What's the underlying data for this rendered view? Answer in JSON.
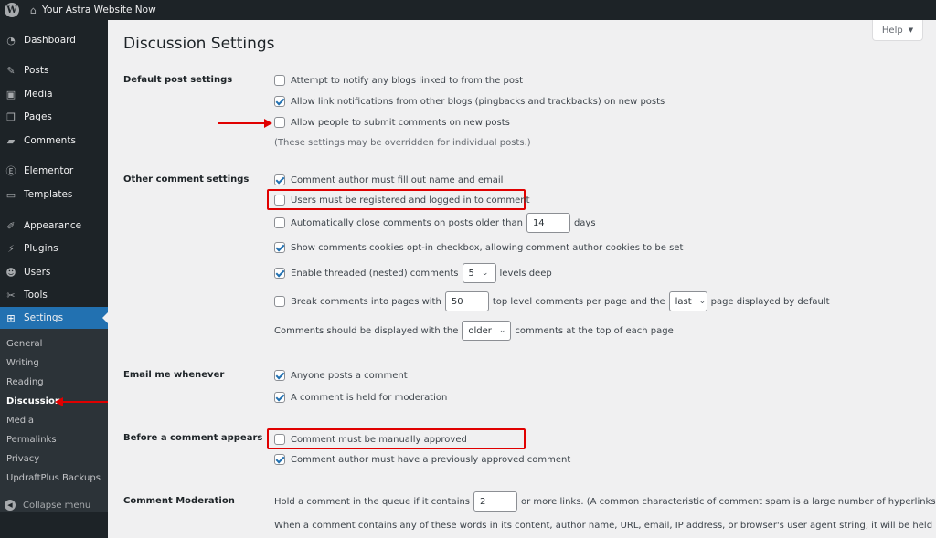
{
  "adminbar": {
    "wp_logo_icon": "wordpress-logo-icon",
    "home_icon": "home-icon",
    "site_name": "Your Astra Website Now"
  },
  "sidebar": {
    "items": [
      {
        "label": "Dashboard",
        "icon": "dashboard-icon",
        "glyph": "◔"
      },
      {
        "label": "Posts",
        "icon": "pin-icon",
        "glyph": "✎"
      },
      {
        "label": "Media",
        "icon": "media-icon",
        "glyph": "▣"
      },
      {
        "label": "Pages",
        "icon": "pages-icon",
        "glyph": "❐"
      },
      {
        "label": "Comments",
        "icon": "comment-icon",
        "glyph": "▰"
      },
      {
        "label": "Elementor",
        "icon": "elementor-icon",
        "glyph": "Ⓔ"
      },
      {
        "label": "Templates",
        "icon": "folder-icon",
        "glyph": "▭"
      },
      {
        "label": "Appearance",
        "icon": "brush-icon",
        "glyph": "✐"
      },
      {
        "label": "Plugins",
        "icon": "plug-icon",
        "glyph": "⚡"
      },
      {
        "label": "Users",
        "icon": "user-icon",
        "glyph": "☻"
      },
      {
        "label": "Tools",
        "icon": "wrench-icon",
        "glyph": "✂"
      },
      {
        "label": "Settings",
        "icon": "settings-icon",
        "glyph": "⊞"
      }
    ],
    "submenu": [
      "General",
      "Writing",
      "Reading",
      "Discussion",
      "Media",
      "Permalinks",
      "Privacy",
      "UpdraftPlus Backups"
    ],
    "current_submenu": "Discussion",
    "collapse_label": "Collapse menu",
    "collapse_glyph": "◀"
  },
  "page": {
    "title": "Discussion Settings",
    "help_label": "Help",
    "help_glyph": "▼"
  },
  "sections": {
    "default_post": {
      "label": "Default post settings",
      "options": [
        {
          "label": "Attempt to notify any blogs linked to from the post",
          "checked": false
        },
        {
          "label": "Allow link notifications from other blogs (pingbacks and trackbacks) on new posts",
          "checked": true
        },
        {
          "label": "Allow people to submit comments on new posts",
          "checked": false
        }
      ],
      "note": "(These settings may be overridden for individual posts.)"
    },
    "other_comment": {
      "label": "Other comment settings",
      "author_fill": {
        "label": "Comment author must fill out name and email",
        "checked": true
      },
      "registered": {
        "label": "Users must be registered and logged in to comment",
        "checked": false
      },
      "auto_close": {
        "label": "Automatically close comments on posts older than",
        "checked": false,
        "value": "14",
        "suffix": "days"
      },
      "cookies": {
        "label": "Show comments cookies opt-in checkbox, allowing comment author cookies to be set",
        "checked": true
      },
      "threaded": {
        "label": "Enable threaded (nested) comments",
        "checked": true,
        "value": "5",
        "suffix": "levels deep"
      },
      "paging": {
        "label": "Break comments into pages with",
        "checked": false,
        "value": "50",
        "middle": "top level comments per page and the",
        "select": "last",
        "suffix": "page displayed by default"
      },
      "order": {
        "prefix": "Comments should be displayed with the",
        "select": "older",
        "suffix": "comments at the top of each page"
      }
    },
    "email": {
      "label": "Email me whenever",
      "options": [
        {
          "label": "Anyone posts a comment",
          "checked": true
        },
        {
          "label": "A comment is held for moderation",
          "checked": true
        }
      ]
    },
    "before_appears": {
      "label": "Before a comment appears",
      "options": [
        {
          "label": "Comment must be manually approved",
          "checked": false
        },
        {
          "label": "Comment author must have a previously approved comment",
          "checked": true
        }
      ]
    },
    "moderation": {
      "label": "Comment Moderation",
      "hold_prefix": "Hold a comment in the queue if it contains",
      "hold_value": "2",
      "hold_suffix": "or more links. (A common characteristic of comment spam is a large number of hyperlinks.)",
      "words_text": "When a comment contains any of these words in its content, author name, URL, email, IP address, or browser's user agent string, it will be held in the"
    }
  },
  "annotations": {
    "highlight_color": "#e00000"
  }
}
